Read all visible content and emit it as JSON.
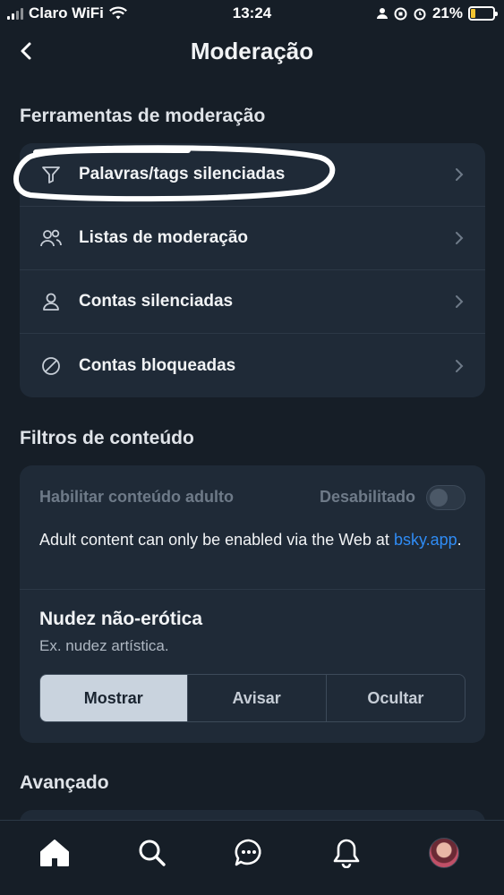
{
  "status_bar": {
    "carrier": "Claro WiFi",
    "time": "13:24",
    "battery_percent": "21%",
    "battery_level": 0.21,
    "battery_color": "#f4c430"
  },
  "header": {
    "title": "Moderação",
    "back_icon": "chevron-left-icon"
  },
  "moderation_tools": {
    "section_title": "Ferramentas de moderação",
    "items": [
      {
        "label": "Palavras/tags silenciadas",
        "icon": "filter-icon"
      },
      {
        "label": "Listas de moderação",
        "icon": "users-icon"
      },
      {
        "label": "Contas silenciadas",
        "icon": "user-icon"
      },
      {
        "label": "Contas bloqueadas",
        "icon": "block-icon"
      }
    ]
  },
  "content_filters": {
    "section_title": "Filtros de conteúdo",
    "adult_content": {
      "label": "Habilitar conteúdo adulto",
      "status": "Desabilitado",
      "enabled": false,
      "note_text": "Adult content can only be enabled via the Web at ",
      "note_link": "bsky.app",
      "note_end": "."
    },
    "nudity": {
      "title": "Nudez não-erótica",
      "description": "Ex. nudez artística.",
      "options": [
        "Mostrar",
        "Avisar",
        "Ocultar"
      ],
      "selected": "Mostrar"
    }
  },
  "advanced": {
    "section_title": "Avançado"
  },
  "tab_bar": {
    "tabs": [
      "home-icon",
      "search-icon",
      "chat-icon",
      "bell-icon",
      "avatar"
    ]
  },
  "colors": {
    "background": "#161e27",
    "card": "#1f2a37",
    "link": "#2f8cf5"
  }
}
